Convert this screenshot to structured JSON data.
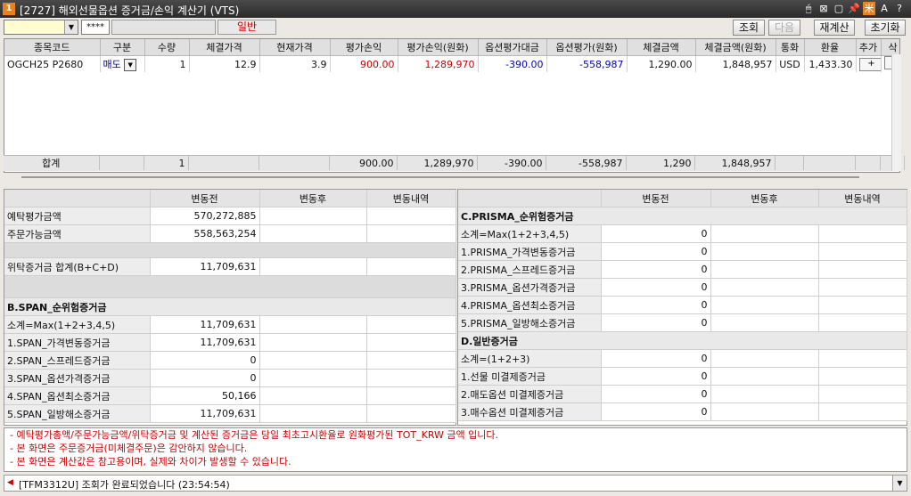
{
  "window": {
    "badge": "1",
    "title": "[2727] 해외선물옵션 증거금/손익 계산기 (VTS)"
  },
  "title_icons": [
    "🖱",
    "⊠",
    "▢",
    "📌",
    "米",
    "A",
    "?"
  ],
  "toolbar": {
    "password_mask": "****",
    "mode_label": "일반",
    "btn_query": "조회",
    "btn_next": "다음",
    "btn_recalc": "재계산",
    "btn_reset": "초기화"
  },
  "grid": {
    "headers": [
      "종목코드",
      "구분",
      "수량",
      "체결가격",
      "현재가격",
      "평가손익",
      "평가손익(원화)",
      "옵션평가대금",
      "옵션평가(원화)",
      "체결금액",
      "체결금액(원화)",
      "통화",
      "환율",
      "추가",
      "삭"
    ],
    "row": {
      "code": "OGCH25 P2680",
      "side": "매도",
      "qty": "1",
      "fill_price": "12.9",
      "cur_price": "3.9",
      "pnl": "900.00",
      "pnl_krw": "1,289,970",
      "opt_val": "-390.00",
      "opt_val_krw": "-558,987",
      "fill_amt": "1,290.00",
      "fill_amt_krw": "1,848,957",
      "currency": "USD",
      "fx": "1,433.30",
      "add": "+"
    },
    "total": {
      "label": "합계",
      "qty": "1",
      "pnl": "900.00",
      "pnl_krw": "1,289,970",
      "opt_val": "-390.00",
      "opt_val_krw": "-558,987",
      "fill_amt": "1,290",
      "fill_amt_krw": "1,848,957"
    }
  },
  "left_panel": {
    "headers": [
      "변동전",
      "변동후",
      "변동내역"
    ],
    "rows": [
      {
        "label": "예탁평가금액",
        "before": "570,272,885"
      },
      {
        "label": "주문가능금액",
        "before": "558,563,254"
      }
    ],
    "deposit": {
      "label": "위탁증거금 합계(B+C+D)",
      "before": "11,709,631"
    },
    "span_title": "B.SPAN_순위험증거금",
    "span_rows": [
      {
        "label": "소계=Max(1+2+3,4,5)",
        "before": "11,709,631"
      },
      {
        "label": "1.SPAN_가격변동증거금",
        "before": "11,709,631"
      },
      {
        "label": "2.SPAN_스프레드증거금",
        "before": "0"
      },
      {
        "label": "3.SPAN_옵션가격증거금",
        "before": "0"
      },
      {
        "label": "4.SPAN_옵션최소증거금",
        "before": "50,166"
      },
      {
        "label": "5.SPAN_일방해소증거금",
        "before": "11,709,631"
      }
    ]
  },
  "right_panel": {
    "headers": [
      "변동전",
      "변동후",
      "변동내역"
    ],
    "prisma_title": "C.PRISMA_순위험증거금",
    "prisma_rows": [
      {
        "label": "소계=Max(1+2+3,4,5)",
        "before": "0"
      },
      {
        "label": "1.PRISMA_가격변동증거금",
        "before": "0"
      },
      {
        "label": "2.PRISMA_스프레드증거금",
        "before": "0"
      },
      {
        "label": "3.PRISMA_옵션가격증거금",
        "before": "0"
      },
      {
        "label": "4.PRISMA_옵션최소증거금",
        "before": "0"
      },
      {
        "label": "5.PRISMA_일방해소증거금",
        "before": "0"
      }
    ],
    "general_title": "D.일반증거금",
    "general_rows": [
      {
        "label": "소계=(1+2+3)",
        "before": "0"
      },
      {
        "label": "1.선물 미결제증거금",
        "before": "0"
      },
      {
        "label": "2.매도옵션 미결제증거금",
        "before": "0"
      },
      {
        "label": "3.매수옵션 미결제증거금",
        "before": "0"
      }
    ]
  },
  "notes": [
    "- 예탁평가총액/주문가능금액/위탁증거금 및 계산된 증거금은 당일 최초고시환율로 원화평가된 TOT_KRW 금액 입니다.",
    "- 본 화면은 주문증거금(미체결주문)은 감안하지 않습니다.",
    "- 본 화면은 계산값은 참고용이며, 실제와 차이가 발생할 수 있습니다."
  ],
  "status": "[TFM3312U] 조회가 완료되었습니다 (23:54:54)"
}
